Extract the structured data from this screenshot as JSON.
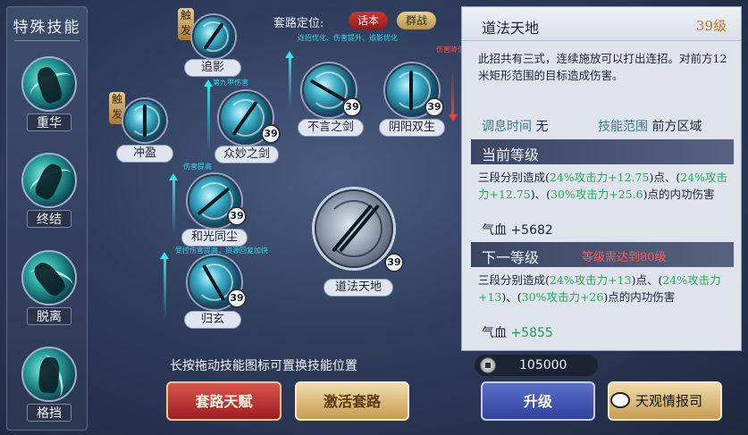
{
  "left_panel": {
    "title": "特殊技能",
    "skills": [
      {
        "label": "重华"
      },
      {
        "label": "终结"
      },
      {
        "label": "脱离"
      },
      {
        "label": "格挡"
      }
    ]
  },
  "route": {
    "label": "套路定位:",
    "tags": [
      "话本",
      "群战"
    ],
    "notes": [
      "连招优化、伤害提升、追影优化",
      "伤害提升",
      "第九甲伤害",
      "伤害提高",
      "受控伤害提高，资源回复加快"
    ],
    "red_note": "伤害降低"
  },
  "tree": {
    "trigger_text": "触发",
    "nodes": [
      {
        "id": "zhuiying",
        "label": "追影",
        "trigger": true,
        "level": ""
      },
      {
        "id": "chongying",
        "label": "冲盈",
        "trigger": true,
        "level": ""
      },
      {
        "id": "zhongmiao",
        "label": "众妙之剑",
        "level": "39"
      },
      {
        "id": "buyan",
        "label": "不言之剑",
        "level": "39"
      },
      {
        "id": "yinyang",
        "label": "阴阳双生",
        "level": "39"
      },
      {
        "id": "heguang",
        "label": "和光同尘",
        "level": "39"
      },
      {
        "id": "guixuan",
        "label": "归玄",
        "level": "39"
      },
      {
        "id": "daofa",
        "label": "道法天地",
        "level": "39"
      }
    ]
  },
  "hint": "长按拖动技能图标可置换技能位置",
  "buttons": {
    "talent": "套路天赋",
    "activate": "激活套路",
    "upgrade": "升级"
  },
  "detail": {
    "name": "道法天地",
    "level": "39级",
    "description": "此招共有三式，连续施放可以打出连招。对前方12米矩形范围的目标造成伤害。",
    "cooldown_key": "调息时间",
    "cooldown_val": "无",
    "range_key": "技能范围",
    "range_val": "前方区域",
    "current": {
      "title": "当前等级",
      "text_a": "三段分别造成(",
      "p1": "24%攻击力+12.75",
      "text_b": ")点、(",
      "p2": "24%攻击力+12.75",
      "text_c": ")、(",
      "p3": "30%攻击力+25.6",
      "text_d": ")点的内功伤害",
      "hp_label": "气血",
      "hp_value": "+5682"
    },
    "next": {
      "title": "下一等级",
      "requirement": "等级需达到80级",
      "text_a": "三段分别造成(",
      "p1": "24%攻击力+13",
      "text_b": ")点、(",
      "p2": "24%攻击力+13",
      "text_c": ")、(",
      "p3": "30%攻击力+26",
      "text_d": ")点的内功伤害",
      "hp_label": "气血",
      "hp_value": "+5855"
    }
  },
  "currency": {
    "amount": "105000"
  },
  "watermark": "天观情报司",
  "colors": {
    "accent_teal": "#32e4e4",
    "red": "#c53737",
    "gold": "#c79c55",
    "upgrade_blue": "#33429a"
  }
}
